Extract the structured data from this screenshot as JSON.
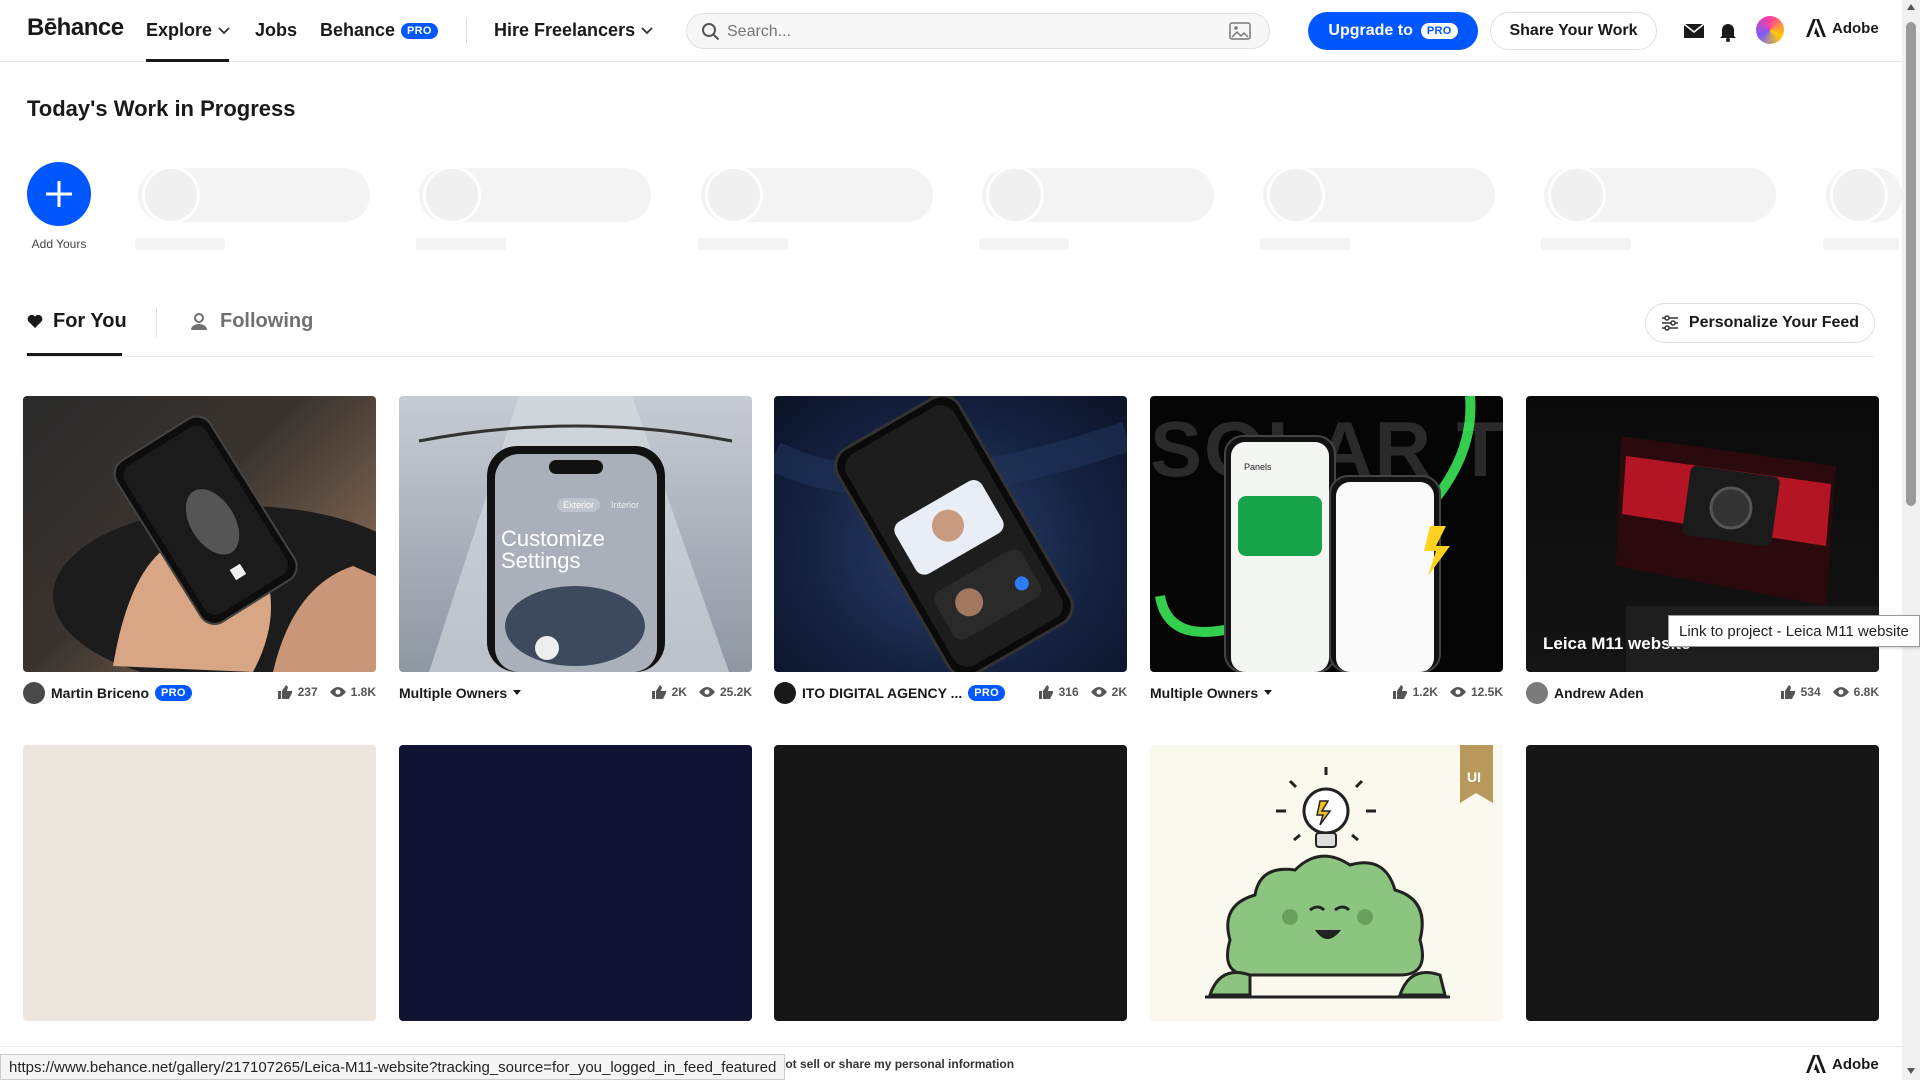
{
  "nav": {
    "logo": "Bēhance",
    "explore": "Explore",
    "jobs": "Jobs",
    "behance": "Behance",
    "pro": "PRO",
    "hire": "Hire Freelancers",
    "search_placeholder": "Search...",
    "upgrade": "Upgrade to",
    "share": "Share Your Work",
    "adobe": "Adobe",
    "icons": [
      "search-icon",
      "image-search-icon",
      "mail-icon",
      "bell-icon",
      "avatar",
      "adobe-logo-icon"
    ]
  },
  "wip": {
    "title": "Today's Work in Progress",
    "add_label": "Add Yours"
  },
  "tabs": {
    "for_you": "For You",
    "following": "Following",
    "personalize": "Personalize Your Feed"
  },
  "cards_row1": [
    {
      "owner": "Martin Briceno",
      "pro": true,
      "appreciations": "237",
      "views": "1.8K",
      "multiple": false,
      "overlay_title": ""
    },
    {
      "owner": "Multiple Owners",
      "pro": false,
      "appreciations": "2K",
      "views": "25.2K",
      "multiple": true,
      "overlay_title": ""
    },
    {
      "owner": "ITO DIGITAL AGENCY ...",
      "pro": true,
      "appreciations": "316",
      "views": "2K",
      "multiple": false,
      "overlay_title": ""
    },
    {
      "owner": "Multiple Owners",
      "pro": false,
      "appreciations": "1.2K",
      "views": "12.5K",
      "multiple": true,
      "overlay_title": ""
    },
    {
      "owner": "Andrew Aden",
      "pro": false,
      "appreciations": "534",
      "views": "6.8K",
      "multiple": false,
      "overlay_title": "Leica M11 website"
    }
  ],
  "thumb_texts": {
    "customize": "Customize Settings",
    "exterior": "Exterior",
    "interior": "Interior",
    "solar": "SOLAR TI",
    "panels": "Panels",
    "ui_ribbon": "UI"
  },
  "colors": {
    "brand": "#0057ff",
    "row2_thumbs": [
      "#ece6df",
      "#111333",
      "#161616",
      "#fbf8ed",
      "#161616"
    ]
  },
  "tooltip": "Link to project - Leica M11 website",
  "status_url": "https://www.behance.net/gallery/217107265/Leica-M11-website?tracking_source=for_you_logged_in_feed_featured",
  "footer": {
    "privacy": "not sell or share my personal information",
    "adobe": "Adobe"
  }
}
